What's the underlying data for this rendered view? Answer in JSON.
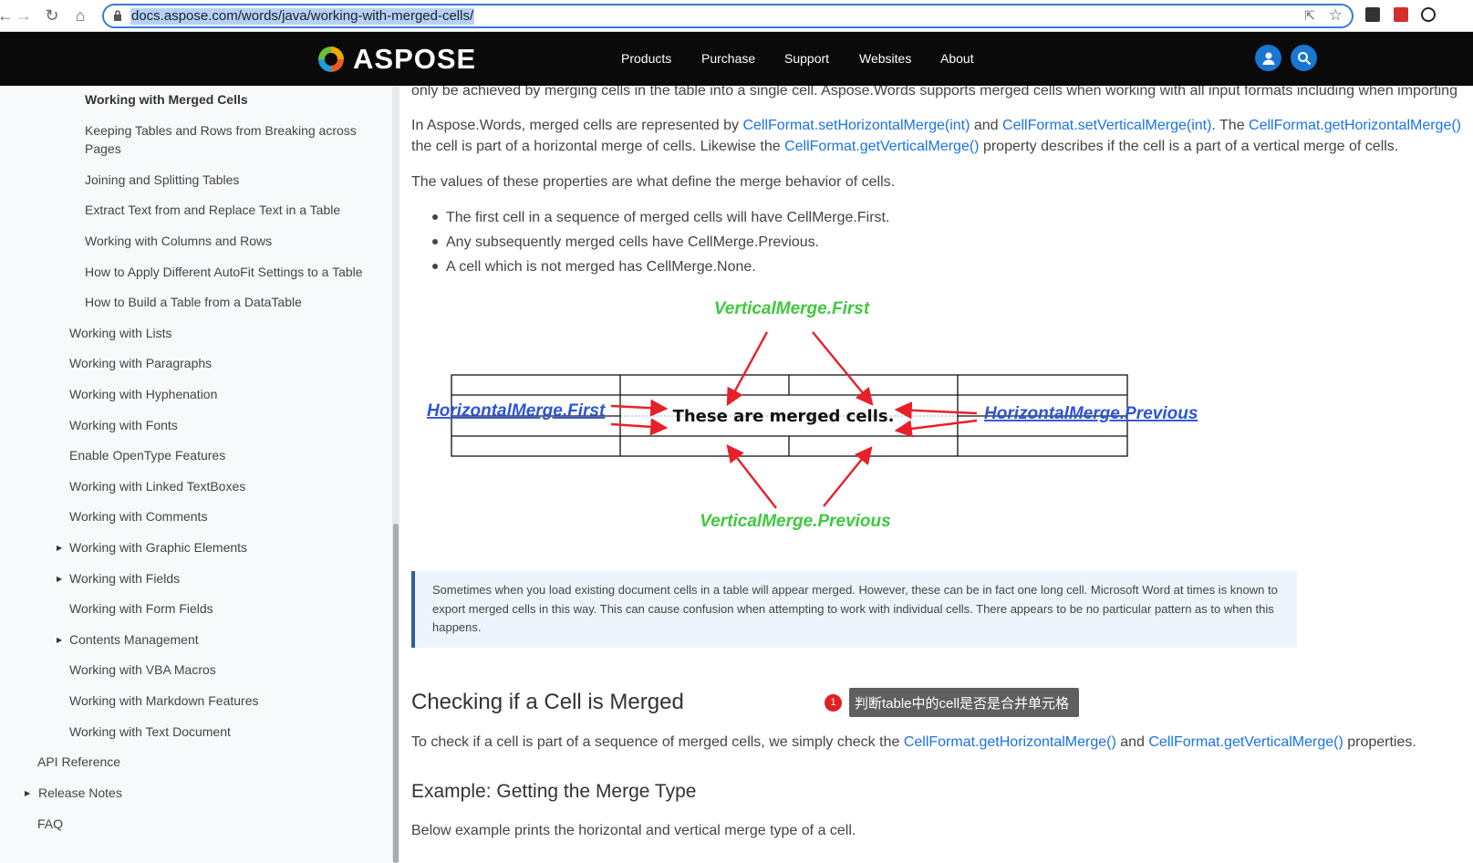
{
  "browser": {
    "url": "docs.aspose.com/words/java/working-with-merged-cells/"
  },
  "header": {
    "brand": "ASPOSE",
    "menu": [
      "Products",
      "Purchase",
      "Support",
      "Websites",
      "About"
    ]
  },
  "sidebar": {
    "items": [
      {
        "label": "Working with Merged Cells",
        "level": 2,
        "active": true
      },
      {
        "label": "Keeping Tables and Rows from Breaking across",
        "label2": "Pages",
        "level": 2
      },
      {
        "label": "Joining and Splitting Tables",
        "level": 2
      },
      {
        "label": "Extract Text from and Replace Text in a Table",
        "level": 2
      },
      {
        "label": "Working with Columns and Rows",
        "level": 2
      },
      {
        "label": "How to Apply Different AutoFit Settings to a Table",
        "level": 2
      },
      {
        "label": "How to Build a Table from a DataTable",
        "level": 2
      },
      {
        "label": "Working with Lists",
        "level": 1
      },
      {
        "label": "Working with Paragraphs",
        "level": 1
      },
      {
        "label": "Working with Hyphenation",
        "level": 1
      },
      {
        "label": "Working with Fonts",
        "level": 1
      },
      {
        "label": "Enable OpenType Features",
        "level": 1
      },
      {
        "label": "Working with Linked TextBoxes",
        "level": 1
      },
      {
        "label": "Working with Comments",
        "level": 1
      },
      {
        "label": "Working with Graphic Elements",
        "level": 1,
        "caret": true
      },
      {
        "label": "Working with Fields",
        "level": 1,
        "caret": true
      },
      {
        "label": "Working with Form Fields",
        "level": 1
      },
      {
        "label": "Contents Management",
        "level": 1,
        "caret": true
      },
      {
        "label": "Working with VBA Macros",
        "level": 1
      },
      {
        "label": "Working with Markdown Features",
        "level": 1
      },
      {
        "label": "Working with Text Document",
        "level": 1
      },
      {
        "label": "API Reference",
        "level": 0
      },
      {
        "label": "Release Notes",
        "level": 0,
        "caret": true
      },
      {
        "label": "FAQ",
        "level": 0
      }
    ]
  },
  "content": {
    "intro_cut": "only be achieved by merging cells in the table into a single cell. Aspose.Words supports merged cells when working with all input formats including when importing",
    "p1_a": "In Aspose.Words, merged cells are represented by ",
    "p1_link1": "CellFormat.setHorizontalMerge(int)",
    "p1_b": " and ",
    "p1_link2": "CellFormat.setVerticalMerge(int)",
    "p1_c": ". The ",
    "p1_link3": "CellFormat.getHorizontalMerge()",
    "p2_a": "the cell is part of a horizontal merge of cells. Likewise the ",
    "p2_link": "CellFormat.getVerticalMerge()",
    "p2_b": " property describes if the cell is a part of a vertical merge of cells.",
    "p3": "The values of these properties are what define the merge behavior of cells.",
    "bullets": [
      "The first cell in a sequence of merged cells will have CellMerge.First.",
      "Any subsequently merged cells have CellMerge.Previous.",
      "A cell which is not merged has CellMerge.None."
    ],
    "diagram": {
      "top_label": "VerticalMerge.First",
      "bottom_label": "VerticalMerge.Previous",
      "left_label": "HorizontalMerge.First",
      "right_label": "HorizontalMerge.Previous",
      "center_text": "These are merged cells.",
      "green": "#3ec93e",
      "blue": "#2f55d4",
      "red": "#e8202a"
    },
    "note": "Sometimes when you load existing document cells in a table will appear merged. However, these can be in fact one long cell. Microsoft Word at times is known to export merged cells in this way. This can cause confusion when attempting to work with individual cells. There appears to be no particular pattern as to when this happens.",
    "h2": "Checking if a Cell is Merged",
    "tooltip_num": "1",
    "tooltip": "判断table中的cell是否是合并单元格",
    "p4_a": "To check if a cell is part of a sequence of merged cells, we simply check the ",
    "p4_link1": "CellFormat.getHorizontalMerge()",
    "p4_b": " and ",
    "p4_link2": "CellFormat.getVerticalMerge()",
    "p4_c": " properties.",
    "h3": "Example: Getting the Merge Type",
    "p5": "Below example prints the horizontal and vertical merge type of a cell."
  }
}
